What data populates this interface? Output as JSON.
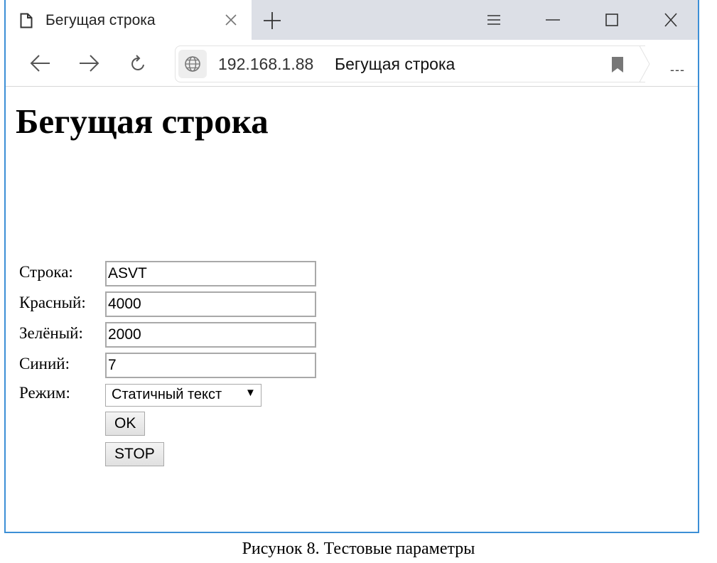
{
  "browser": {
    "tab": {
      "title": "Бегущая строка",
      "icon": "document-icon"
    },
    "new_tab_icon": "plus-icon",
    "window_controls": [
      "menu-icon",
      "minimize-icon",
      "maximize-icon",
      "close-icon"
    ],
    "address_bar": {
      "url": "192.168.1.88",
      "page_title": "Бегущая строка",
      "site_icon": "globe-icon",
      "bookmark_icon": "bookmark-icon"
    },
    "menu_label": "---",
    "border_color": "#3c8fd6"
  },
  "page": {
    "heading": "Бегущая строка",
    "form": {
      "fields": [
        {
          "label": "Строка:",
          "value": "ASVT"
        },
        {
          "label": "Красный:",
          "value": "4000"
        },
        {
          "label": "Зелёный:",
          "value": "2000"
        },
        {
          "label": "Синий:",
          "value": "7"
        }
      ],
      "mode": {
        "label": "Режим:",
        "selected": "Статичный текст"
      },
      "ok_button": "OK",
      "stop_button": "STOP"
    }
  },
  "caption": "Рисунок 8. Тестовые параметры"
}
